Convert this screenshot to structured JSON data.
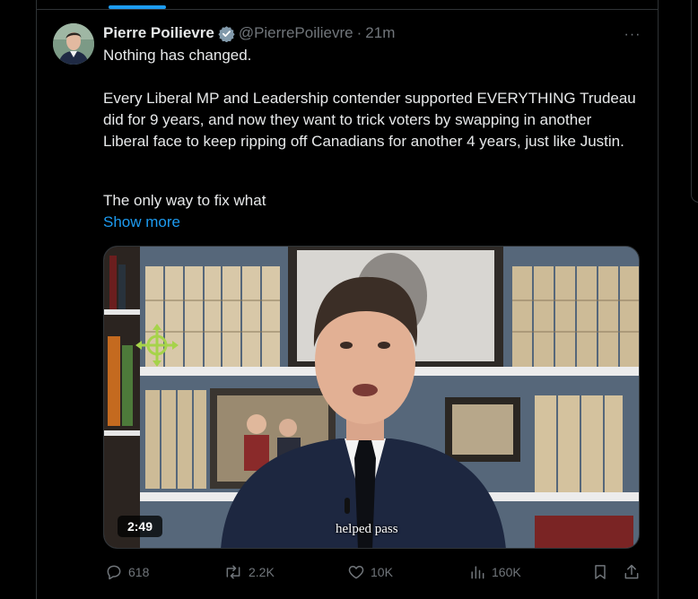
{
  "tweet": {
    "author_name": "Pierre Poilievre",
    "handle": "@PierrePoilievre",
    "separator": "·",
    "time": "21m",
    "verified_icon": "verified-badge-icon",
    "paragraphs": [
      "Nothing has changed.",
      "Every Liberal MP and Leadership contender supported EVERYTHING Trudeau did for 9 years, and now they want to trick voters by swapping in another Liberal face to keep ripping off Canadians for another 4 years, just like Justin.",
      "The only way to fix what"
    ],
    "show_more": "Show more",
    "more_icon": "···"
  },
  "media": {
    "duration": "2:49",
    "caption": "helped pass"
  },
  "actions": {
    "replies": "618",
    "reposts": "2.2K",
    "likes": "10K",
    "views": "160K"
  },
  "colors": {
    "background": "#000000",
    "text": "#e7e9ea",
    "secondary": "#71767b",
    "accent": "#1d9bf0",
    "border": "#2f3336"
  }
}
